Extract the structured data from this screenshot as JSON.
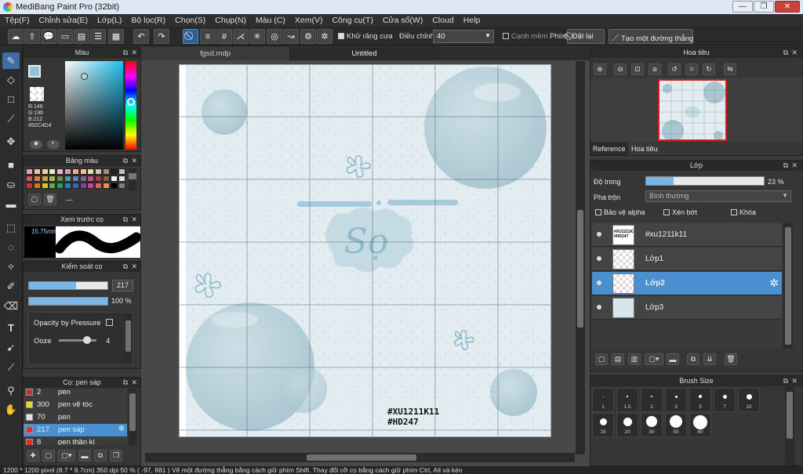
{
  "window": {
    "title": "MediBang Paint Pro (32bit)",
    "controls": [
      "—",
      "❐",
      "✕"
    ]
  },
  "menu": [
    "Tệp(F)",
    "Chỉnh sửa(E)",
    "Lớp(L)",
    "Bộ lọc(R)",
    "Chọn(S)",
    "Chụp(N)",
    "Màu (C)",
    "Xem(V)",
    "Công cụ(T)",
    "Cửa sổ(W)",
    "Cloud",
    "Help"
  ],
  "toolbar": {
    "antialias_label": "Khử răng cưa",
    "adjust_label": "Điều chỉnh",
    "adjust_value": "40",
    "smooth_edge_label": "Cạnh mềm",
    "key_label": "Phím",
    "reset_label": "Đặt lại",
    "straight_line_label": "Tạo một đường thẳng"
  },
  "color_panel": {
    "title": "Màu",
    "r": "R:146",
    "g": "G:196",
    "b": "B:212",
    "hex": "#92C4D4",
    "primary_color": "#92c4d4"
  },
  "palette_panel": {
    "title": "Bảng màu",
    "extra": "---",
    "swatches": [
      "#e8a0a0",
      "#f0c0a0",
      "#f0d0a0",
      "#f8e8b0",
      "#e8b8c8",
      "#d0a0b0",
      "#f0a890",
      "#f4c090",
      "#e8d8a8",
      "#d8c0a0",
      "#b08870",
      "#202020",
      "#c0c0c0",
      "#c06060",
      "#d08040",
      "#c8a050",
      "#a0b860",
      "#609050",
      "#40a0a0",
      "#6080c0",
      "#8060a0",
      "#c05080",
      "#a04040",
      "#806040",
      "#f0f0f0",
      "#e0e0e0",
      "#d03030",
      "#e07020",
      "#e0c020",
      "#60b040",
      "#20a060",
      "#2080c0",
      "#4060c0",
      "#8040a0",
      "#d04090",
      "#e06060",
      "#f09040",
      "#000000",
      "#808080"
    ]
  },
  "preview_panel": {
    "title": "Xem trước cọ",
    "size": "15.75mm"
  },
  "brush_control": {
    "title": "Kiểm soát cọ",
    "size_value": "217",
    "opacity_value": "100 %",
    "pressure_label": "Opacity by Pressure",
    "ooze_label": "Ooze",
    "ooze_value": "4",
    "size_level": 0.6,
    "opacity_level": 1.0,
    "ooze_level": 0.75
  },
  "brush_panel": {
    "title": "Cọ: pen sáp",
    "items": [
      {
        "num": "2",
        "name": "pen",
        "color": "#c03030"
      },
      {
        "num": "300",
        "name": "pen vẽ tóc",
        "color": "#e8d820"
      },
      {
        "num": "70",
        "name": "pen",
        "color": "#e0e0e0"
      },
      {
        "num": "217",
        "name": "pen sáp",
        "color": "#e03030",
        "selected": true
      },
      {
        "num": "8",
        "name": "pen thần kì",
        "color": "#e03030"
      }
    ]
  },
  "document_tabs": [
    "fgsd.mdp",
    "Untitled"
  ],
  "artwork": {
    "signature_line1": "#XU1211K11",
    "signature_line2": "#HD247"
  },
  "navigator_panel": {
    "title": "Hoa tiêu",
    "tabs": [
      "Reference",
      "Hoa tiêu"
    ]
  },
  "layer_panel": {
    "title": "Lớp",
    "opacity_label": "Độ trong",
    "opacity_value": "23 %",
    "opacity_level": 0.23,
    "blend_label": "Pha trộn",
    "blend_value": "Bình thường",
    "protect_alpha": "Bảo vệ alpha",
    "clipping": "Xén bớt",
    "lock": "Khóa",
    "layers": [
      {
        "name": "#xu1211k11",
        "thumb_text": "#XU1211K11 #HD247"
      },
      {
        "name": "Lớp1"
      },
      {
        "name": "Lớp2",
        "selected": true
      },
      {
        "name": "Lớp3"
      }
    ]
  },
  "brush_size_panel": {
    "title": "Brush Size",
    "sizes": [
      "1",
      "1.5",
      "2",
      "3",
      "5",
      "7",
      "10",
      "15",
      "20",
      "30",
      "50",
      "40"
    ]
  },
  "status": "1200 * 1200 pixel  (8.7 * 8.7cm)  350 dpi  50 %  ( -97, 881 )  Vẽ một đường thẳng bằng cách giữ phím Shift. Thay đổi cỡ cọ bằng cách giữ phím Ctrl, Alt và kéo"
}
